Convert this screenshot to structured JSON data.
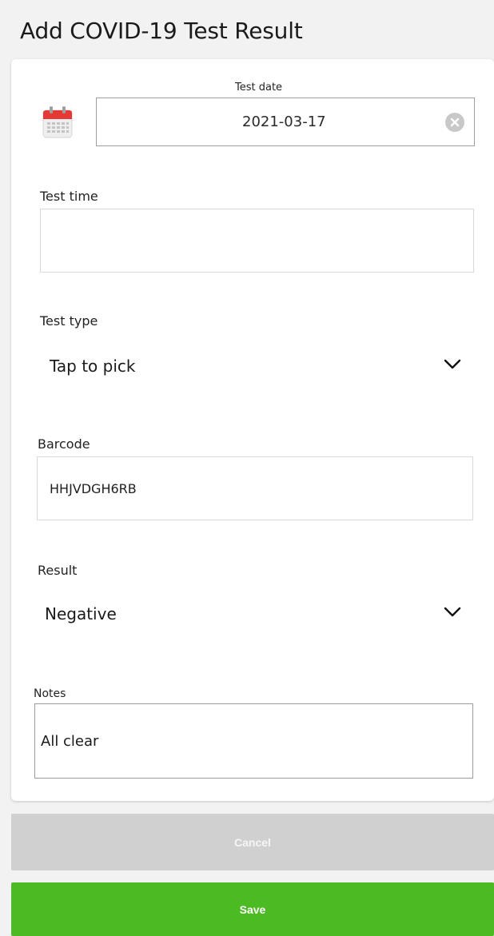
{
  "header": {
    "title": "Add COVID-19 Test Result"
  },
  "test_date": {
    "label": "Test date",
    "value": "2021-03-17",
    "icon": "calendar-icon",
    "clear_icon": "clear-icon"
  },
  "test_time": {
    "label": "Test time",
    "value": ""
  },
  "test_type": {
    "label": "Test type",
    "value": "Tap to pick",
    "icon": "chevron-down-icon"
  },
  "barcode": {
    "label": "Barcode",
    "value": "HHJVDGH6RB"
  },
  "result": {
    "label": "Result",
    "value": "Negative",
    "icon": "chevron-down-icon"
  },
  "notes": {
    "label": "Notes",
    "value": "All clear"
  },
  "actions": {
    "cancel_label": "Cancel",
    "save_label": "Save"
  },
  "colors": {
    "save": "#4cba23",
    "cancel": "#cfd0cf",
    "calendar_red": "#e53935"
  }
}
